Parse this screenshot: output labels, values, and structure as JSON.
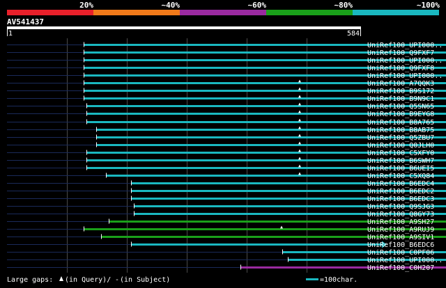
{
  "colors": {
    "background": "#000000",
    "text": "#ffffff",
    "query_bar": "#ffffff",
    "guide_line": "#1a2a5a",
    "grid": "#5a5a5a",
    "gap_marker": "#ffffff",
    "scale": [
      "#e8202a",
      "#f07a1a",
      "#9a2aa0",
      "#1aa01a",
      "#1ab8c0"
    ]
  },
  "scale_bar": {
    "labels": [
      "20%",
      "~40%",
      "~60%",
      "~80%",
      "~100%"
    ]
  },
  "query": {
    "id": "AV541437",
    "start_label": "1",
    "end_label": "584",
    "length": 584
  },
  "chart_data": {
    "type": "alignment",
    "query_length": 584,
    "hits": [
      {
        "name": "UniRef100_UPI000..",
        "start": 120,
        "end": 700,
        "identity_class": 5,
        "gaps": []
      },
      {
        "name": "UniRef100_Q9FXF7",
        "start": 120,
        "end": 700,
        "identity_class": 5,
        "gaps": []
      },
      {
        "name": "UniRef100_UPI000..",
        "start": 120,
        "end": 700,
        "identity_class": 5,
        "gaps": []
      },
      {
        "name": "UniRef100_Q9FXF8",
        "start": 120,
        "end": 700,
        "identity_class": 5,
        "gaps": []
      },
      {
        "name": "UniRef100_UPI000..",
        "start": 120,
        "end": 700,
        "identity_class": 5,
        "gaps": []
      },
      {
        "name": "UniRef100_A7QQK3",
        "start": 120,
        "end": 700,
        "identity_class": 5,
        "gaps": [
          430
        ]
      },
      {
        "name": "UniRef100_B9S172",
        "start": 120,
        "end": 700,
        "identity_class": 5,
        "gaps": [
          430
        ]
      },
      {
        "name": "UniRef100_B9N9C1",
        "start": 120,
        "end": 700,
        "identity_class": 5,
        "gaps": [
          430
        ]
      },
      {
        "name": "UniRef100_Q5SN65",
        "start": 124,
        "end": 700,
        "identity_class": 5,
        "gaps": [
          430
        ]
      },
      {
        "name": "UniRef100_B9EYG8",
        "start": 124,
        "end": 700,
        "identity_class": 5,
        "gaps": [
          430
        ]
      },
      {
        "name": "UniRef100_B8A765",
        "start": 124,
        "end": 700,
        "identity_class": 5,
        "gaps": [
          430
        ]
      },
      {
        "name": "UniRef100_B8AB75",
        "start": 138,
        "end": 700,
        "identity_class": 5,
        "gaps": [
          430
        ]
      },
      {
        "name": "UniRef100_Q5ZBU7",
        "start": 138,
        "end": 700,
        "identity_class": 5,
        "gaps": [
          430
        ]
      },
      {
        "name": "UniRef100_Q0JLH0",
        "start": 138,
        "end": 700,
        "identity_class": 5,
        "gaps": [
          430
        ]
      },
      {
        "name": "UniRef100_C5XFY0",
        "start": 124,
        "end": 700,
        "identity_class": 5,
        "gaps": [
          430
        ]
      },
      {
        "name": "UniRef100_B6SWH7",
        "start": 124,
        "end": 700,
        "identity_class": 5,
        "gaps": [
          430
        ]
      },
      {
        "name": "UniRef100_B6UEI5",
        "start": 124,
        "end": 700,
        "identity_class": 5,
        "gaps": [
          430
        ]
      },
      {
        "name": "UniRef100_C5XQ84",
        "start": 152,
        "end": 700,
        "identity_class": 5,
        "gaps": [
          430
        ]
      },
      {
        "name": "UniRef100_B6EDC4",
        "start": 188,
        "end": 700,
        "identity_class": 5,
        "gaps": []
      },
      {
        "name": "UniRef100_B6EDC2",
        "start": 188,
        "end": 700,
        "identity_class": 5,
        "gaps": []
      },
      {
        "name": "UniRef100_B6EDC3",
        "start": 188,
        "end": 700,
        "identity_class": 5,
        "gaps": []
      },
      {
        "name": "UniRef100_Q9SJG3",
        "start": 192,
        "end": 700,
        "identity_class": 5,
        "gaps": []
      },
      {
        "name": "UniRef100_Q8GY73",
        "start": 192,
        "end": 700,
        "identity_class": 5,
        "gaps": []
      },
      {
        "name": "UniRef100_A9SH27",
        "start": 156,
        "end": 700,
        "identity_class": 4,
        "gaps": []
      },
      {
        "name": "UniRef100_A9RUJ9",
        "start": 120,
        "end": 690,
        "identity_class": 4,
        "gaps": [
          404
        ]
      },
      {
        "name": "UniRef100_A9SIV1",
        "start": 145,
        "end": 700,
        "identity_class": 4,
        "gaps": []
      },
      {
        "name": "UniRef100_B6EDC6",
        "start": 188,
        "end": 555,
        "identity_class": 5,
        "gaps": []
      },
      {
        "name": "UniRef100_C0PF06",
        "start": 405,
        "end": 700,
        "identity_class": 5,
        "gaps": []
      },
      {
        "name": "UniRef100_UPI000..",
        "start": 413,
        "end": 700,
        "identity_class": 5,
        "gaps": []
      },
      {
        "name": "UniRef100_C0H207",
        "start": 345,
        "end": 650,
        "identity_class": 3,
        "gaps": []
      }
    ]
  },
  "footer": {
    "large_gaps_label": "Large gaps:",
    "query_gap_text": "(in Query)/",
    "subject_gap_symbol": "-",
    "subject_gap_text": " (in Subject)",
    "length_legend_text": "=100char."
  }
}
